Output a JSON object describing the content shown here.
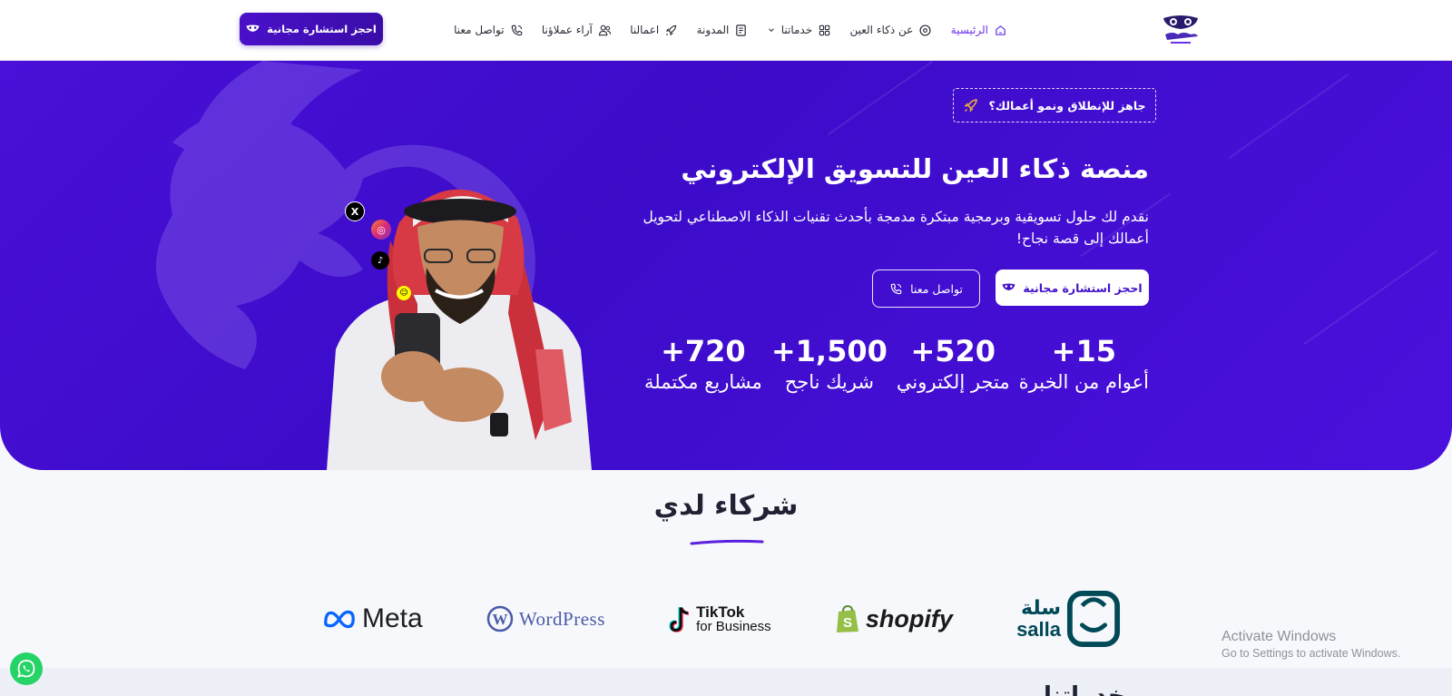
{
  "navbar": {
    "logo_icon": "owl-logo-icon",
    "links": [
      {
        "label": "الرئيسية",
        "icon": "home-icon",
        "active": true
      },
      {
        "label": "عن ذكاء العين",
        "icon": "info-circle-icon"
      },
      {
        "label": "خدماتنا",
        "icon": "grid-icon",
        "has_dropdown": true
      },
      {
        "label": "المدونة",
        "icon": "document-icon"
      },
      {
        "label": "اعمالنا",
        "icon": "rocket-icon"
      },
      {
        "label": "آراء عملاؤنا",
        "icon": "users-icon"
      },
      {
        "label": "تواصل معنا",
        "icon": "phone-icon"
      }
    ],
    "cta_label": "احجز استشارة مجانية"
  },
  "hero": {
    "badge": "جاهز للإنطلاق ونمو أعمالك؟",
    "title": "منصة ذكاء العين للتسويق الإلكتروني",
    "description_line1": "نقدم لك حلول تسويقية وبرمجية مبتكرة مدمجة بأحدث تقنيات الذكاء الاصطناعي لتحويل",
    "description_line2": "أعمالك إلى قصة نجاح!",
    "primary_button": "احجز استشارة مجانية",
    "secondary_button": "تواصل معنا",
    "stats": [
      {
        "value": "+15",
        "label": "أعوام من الخبرة"
      },
      {
        "value": "+520",
        "label": "متجر إلكتروني"
      },
      {
        "value": "+1,500",
        "label": "شريك ناجح"
      },
      {
        "value": "+720",
        "label": "مشاريع مكتملة"
      }
    ],
    "social_icons": [
      "x-icon",
      "instagram-icon",
      "tiktok-icon",
      "snapchat-icon"
    ]
  },
  "partners": {
    "title": "شركاء لدي",
    "logos": {
      "salla_ar": "سلة",
      "salla_en": "salla",
      "shopify": "shopify",
      "tiktok_line1": "TikTok",
      "tiktok_line2": "for Business",
      "wordpress": "WordPress",
      "meta": "Meta"
    }
  },
  "next_section": {
    "title": "خدماتنا"
  },
  "windows_watermark": {
    "line1": "Activate Windows",
    "line2": "Go to Settings to activate Windows."
  },
  "colors": {
    "primary": "#4312c9",
    "accent": "#6a31ee",
    "whatsapp": "#25d366"
  }
}
